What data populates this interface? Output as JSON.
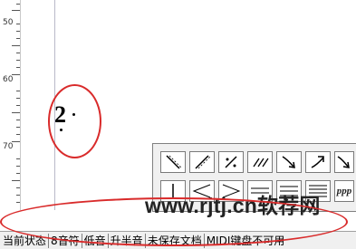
{
  "ruler": {
    "labels": [
      "50",
      "60",
      "70"
    ]
  },
  "notation": {
    "digit": "2"
  },
  "palette": {
    "row1": [
      "diagonal-down-icon",
      "diagonal-up-icon",
      "dotted-slash-icon",
      "tremolo-icon",
      "arrow-down-right-icon",
      "arrow-up-right-icon",
      "arrow-down-right-icon"
    ],
    "row2": [
      "barline-icon",
      "decrescendo-icon",
      "crescendo-icon",
      "double-line-icon",
      "triple-line-icon",
      "quad-line-icon",
      "dynamic-ppp-icon"
    ],
    "dynamic_label": "ppp"
  },
  "watermark": {
    "text": "www.rjtj.cn软荐网"
  },
  "status": {
    "items": [
      "当前状态",
      "8音符",
      "低音",
      "升半音",
      "未保存文档",
      "MIDI键盘不可用"
    ]
  },
  "colors": {
    "annotation": "#d92b2b",
    "watermark": "#222222"
  }
}
